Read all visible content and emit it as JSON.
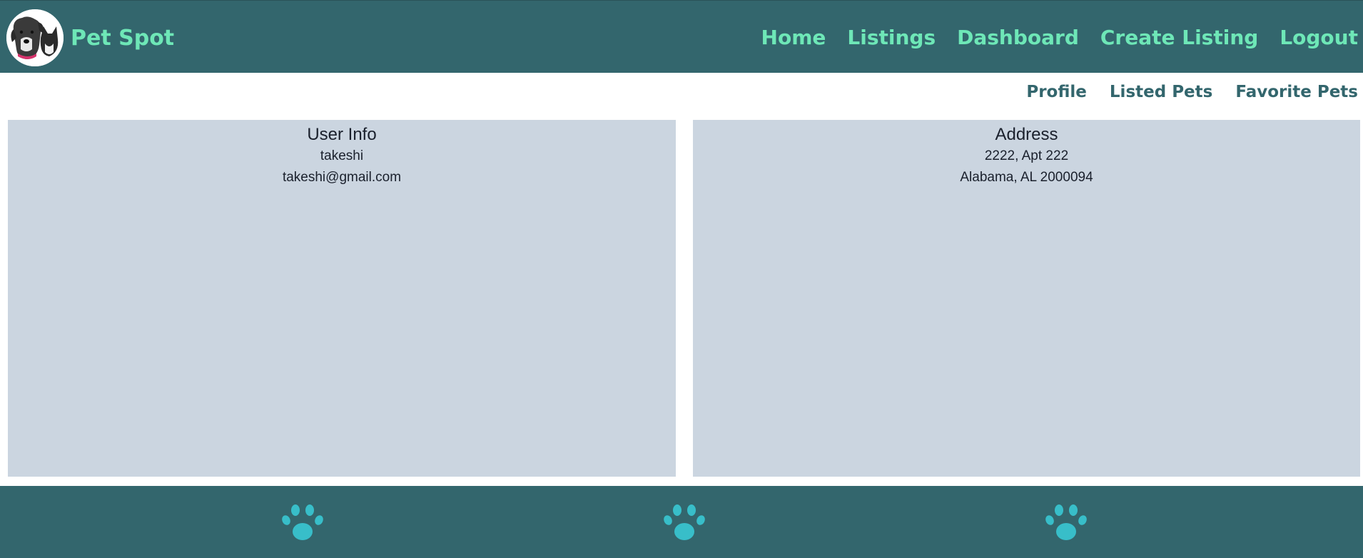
{
  "brand": {
    "name": "Pet Spot",
    "logo_icon": "dog-and-cat-logo-icon"
  },
  "main_nav": {
    "items": [
      {
        "label": "Home"
      },
      {
        "label": "Listings"
      },
      {
        "label": "Dashboard"
      },
      {
        "label": "Create Listing"
      },
      {
        "label": "Logout"
      }
    ]
  },
  "sub_nav": {
    "items": [
      {
        "label": "Profile"
      },
      {
        "label": "Listed Pets"
      },
      {
        "label": "Favorite Pets"
      }
    ]
  },
  "user_info": {
    "heading": "User Info",
    "username": "takeshi",
    "email": "takeshi@gmail.com"
  },
  "address": {
    "heading": "Address",
    "line1": "2222, Apt 222",
    "line2": "Alabama, AL 2000094"
  },
  "footer": {
    "icons": [
      "paw-icon",
      "paw-icon",
      "paw-icon"
    ]
  },
  "colors": {
    "header_bg": "#33666d",
    "nav_text": "#6ee7b7",
    "panel_bg": "#cbd5e0",
    "paw": "#38bec9"
  }
}
